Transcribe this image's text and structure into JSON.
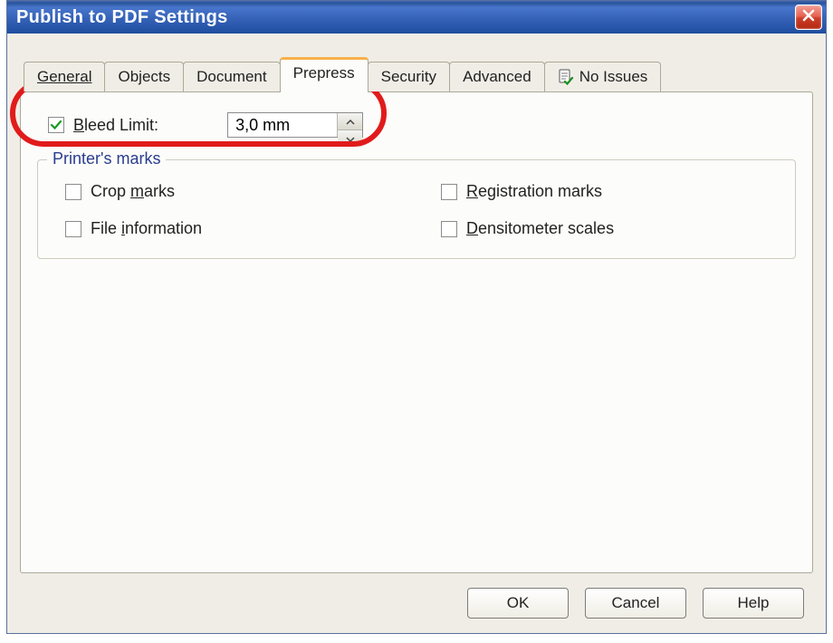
{
  "window": {
    "title": "Publish to PDF Settings"
  },
  "tabs": {
    "general": "General",
    "objects": "Objects",
    "document": "Document",
    "prepress": "Prepress",
    "security": "Security",
    "advanced": "Advanced",
    "no_issues": "No Issues"
  },
  "prepress": {
    "bleed_limit_label_pre": "B",
    "bleed_limit_label_post": "leed Limit:",
    "bleed_limit_value": "3,0 mm",
    "bleed_limit_checked": true,
    "group_title": "Printer's marks",
    "crop_marks_pre": "Crop ",
    "crop_marks_u": "m",
    "crop_marks_post": "arks",
    "registration_pre": "",
    "registration_u": "R",
    "registration_post": "egistration marks",
    "file_info_pre": "File ",
    "file_info_u": "i",
    "file_info_post": "nformation",
    "densitometer_pre": "",
    "densitometer_u": "D",
    "densitometer_post": "ensitometer scales"
  },
  "buttons": {
    "ok": "OK",
    "cancel": "Cancel",
    "help": "Help"
  }
}
